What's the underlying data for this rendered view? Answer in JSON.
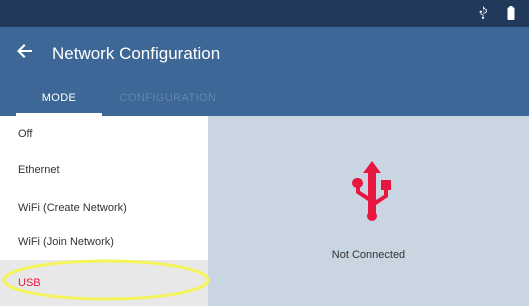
{
  "status_bar": {
    "icons": [
      "usb-icon",
      "battery-icon"
    ]
  },
  "header": {
    "back_icon": "arrow-left-icon",
    "title": "Network Configuration"
  },
  "tabs": [
    {
      "label": "MODE",
      "active": true
    },
    {
      "label": "CONFIGURATION",
      "active": false
    }
  ],
  "modes": [
    {
      "label": "Off",
      "selected": false
    },
    {
      "label": "Ethernet",
      "selected": false
    },
    {
      "label": "WiFi (Create Network)",
      "selected": false
    },
    {
      "label": "WiFi (Join Network)",
      "selected": false
    },
    {
      "label": "USB",
      "selected": true
    }
  ],
  "detail": {
    "icon": "usb-icon",
    "status": "Not Connected"
  },
  "colors": {
    "status_bar": "#213a5b",
    "app_bar": "#3d6796",
    "accent": "#e8173f",
    "content_bg": "#cad5e2",
    "highlight": "#f4f45a"
  }
}
